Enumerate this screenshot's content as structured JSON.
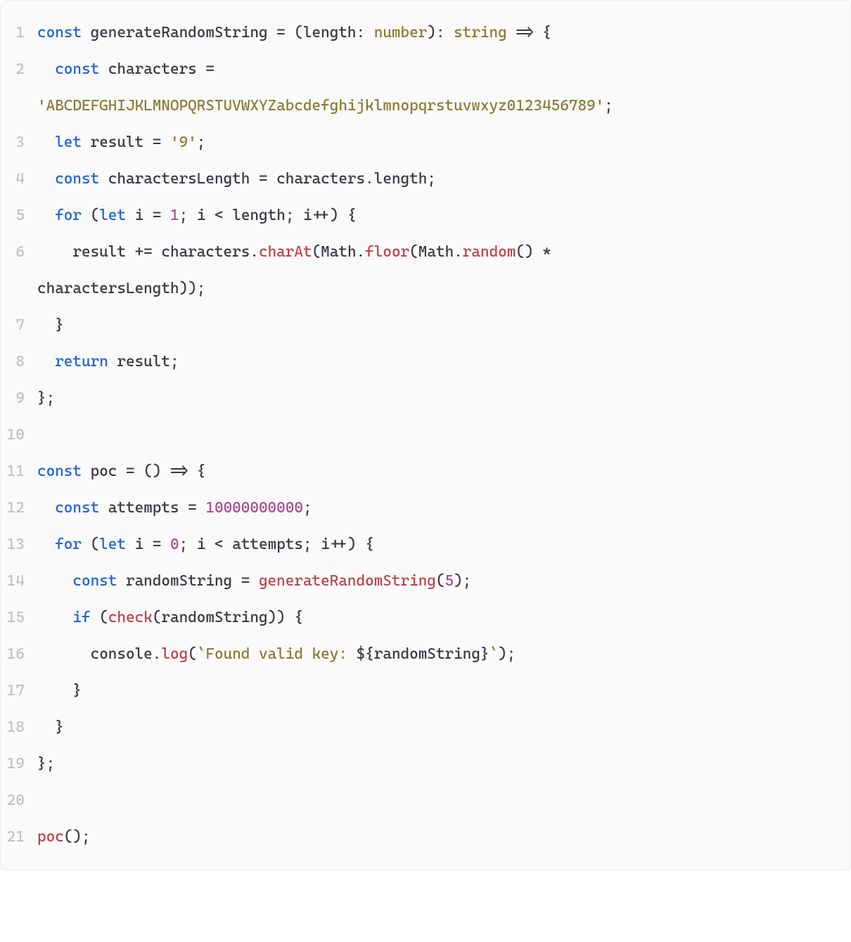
{
  "code": {
    "lines": [
      {
        "num": "1",
        "indent": 0,
        "tokens": [
          {
            "t": "const ",
            "c": "tok-keyword"
          },
          {
            "t": "generateRandomString",
            "c": "tok-def"
          },
          {
            "t": " = (",
            "c": "tok-punct"
          },
          {
            "t": "length",
            "c": "tok-def"
          },
          {
            "t": ": ",
            "c": "tok-punct"
          },
          {
            "t": "number",
            "c": "tok-type"
          },
          {
            "t": "): ",
            "c": "tok-punct"
          },
          {
            "t": "string",
            "c": "tok-type"
          },
          {
            "t": " => {",
            "c": "tok-punct"
          }
        ]
      },
      {
        "num": "2",
        "indent": 1,
        "tokens": [
          {
            "t": "const ",
            "c": "tok-keyword"
          },
          {
            "t": "characters",
            "c": "tok-def"
          },
          {
            "t": " =",
            "c": "tok-op"
          }
        ],
        "wrap_tokens": [
          {
            "t": "'ABCDEFGHIJKLMNOPQRSTUVWXYZabcdefghijklmnopqrstuvwxyz0123456789'",
            "c": "tok-string"
          },
          {
            "t": ";",
            "c": "tok-punct"
          }
        ]
      },
      {
        "num": "3",
        "indent": 1,
        "tokens": [
          {
            "t": "let ",
            "c": "tok-keyword"
          },
          {
            "t": "result",
            "c": "tok-def"
          },
          {
            "t": " = ",
            "c": "tok-op"
          },
          {
            "t": "'9'",
            "c": "tok-string"
          },
          {
            "t": ";",
            "c": "tok-punct"
          }
        ]
      },
      {
        "num": "4",
        "indent": 1,
        "tokens": [
          {
            "t": "const ",
            "c": "tok-keyword"
          },
          {
            "t": "charactersLength",
            "c": "tok-def"
          },
          {
            "t": " = ",
            "c": "tok-op"
          },
          {
            "t": "characters",
            "c": "tok-plain"
          },
          {
            "t": ".",
            "c": "tok-punct"
          },
          {
            "t": "length",
            "c": "tok-plain"
          },
          {
            "t": ";",
            "c": "tok-punct"
          }
        ]
      },
      {
        "num": "5",
        "indent": 1,
        "tokens": [
          {
            "t": "for ",
            "c": "tok-keyword"
          },
          {
            "t": "(",
            "c": "tok-punct"
          },
          {
            "t": "let ",
            "c": "tok-keyword"
          },
          {
            "t": "i",
            "c": "tok-def"
          },
          {
            "t": " = ",
            "c": "tok-op"
          },
          {
            "t": "1",
            "c": "tok-number"
          },
          {
            "t": "; ",
            "c": "tok-punct"
          },
          {
            "t": "i",
            "c": "tok-plain"
          },
          {
            "t": " < ",
            "c": "tok-op"
          },
          {
            "t": "length",
            "c": "tok-plain"
          },
          {
            "t": "; ",
            "c": "tok-punct"
          },
          {
            "t": "i",
            "c": "tok-plain"
          },
          {
            "t": "++",
            "c": "tok-op"
          },
          {
            "t": ") {",
            "c": "tok-punct"
          }
        ]
      },
      {
        "num": "6",
        "indent": 2,
        "tokens": [
          {
            "t": "result",
            "c": "tok-plain"
          },
          {
            "t": " += ",
            "c": "tok-op"
          },
          {
            "t": "characters",
            "c": "tok-plain"
          },
          {
            "t": ".",
            "c": "tok-punct"
          },
          {
            "t": "charAt",
            "c": "tok-call"
          },
          {
            "t": "(",
            "c": "tok-punct"
          },
          {
            "t": "Math",
            "c": "tok-plain"
          },
          {
            "t": ".",
            "c": "tok-punct"
          },
          {
            "t": "floor",
            "c": "tok-call"
          },
          {
            "t": "(",
            "c": "tok-punct"
          },
          {
            "t": "Math",
            "c": "tok-plain"
          },
          {
            "t": ".",
            "c": "tok-punct"
          },
          {
            "t": "random",
            "c": "tok-call"
          },
          {
            "t": "() * ",
            "c": "tok-punct"
          }
        ],
        "wrap_tokens": [
          {
            "t": "charactersLength",
            "c": "tok-plain"
          },
          {
            "t": "));",
            "c": "tok-punct"
          }
        ]
      },
      {
        "num": "7",
        "indent": 1,
        "tokens": [
          {
            "t": "}",
            "c": "tok-punct"
          }
        ]
      },
      {
        "num": "8",
        "indent": 1,
        "tokens": [
          {
            "t": "return ",
            "c": "tok-keyword"
          },
          {
            "t": "result",
            "c": "tok-plain"
          },
          {
            "t": ";",
            "c": "tok-punct"
          }
        ]
      },
      {
        "num": "9",
        "indent": 0,
        "tokens": [
          {
            "t": "};",
            "c": "tok-punct"
          }
        ]
      },
      {
        "num": "10",
        "indent": 0,
        "tokens": []
      },
      {
        "num": "11",
        "indent": 0,
        "tokens": [
          {
            "t": "const ",
            "c": "tok-keyword"
          },
          {
            "t": "poc",
            "c": "tok-def"
          },
          {
            "t": " = () => {",
            "c": "tok-punct"
          }
        ]
      },
      {
        "num": "12",
        "indent": 1,
        "tokens": [
          {
            "t": "const ",
            "c": "tok-keyword"
          },
          {
            "t": "attempts",
            "c": "tok-def"
          },
          {
            "t": " = ",
            "c": "tok-op"
          },
          {
            "t": "10000000000",
            "c": "tok-number"
          },
          {
            "t": ";",
            "c": "tok-punct"
          }
        ]
      },
      {
        "num": "13",
        "indent": 1,
        "tokens": [
          {
            "t": "for ",
            "c": "tok-keyword"
          },
          {
            "t": "(",
            "c": "tok-punct"
          },
          {
            "t": "let ",
            "c": "tok-keyword"
          },
          {
            "t": "i",
            "c": "tok-def"
          },
          {
            "t": " = ",
            "c": "tok-op"
          },
          {
            "t": "0",
            "c": "tok-number"
          },
          {
            "t": "; ",
            "c": "tok-punct"
          },
          {
            "t": "i",
            "c": "tok-plain"
          },
          {
            "t": " < ",
            "c": "tok-op"
          },
          {
            "t": "attempts",
            "c": "tok-plain"
          },
          {
            "t": "; ",
            "c": "tok-punct"
          },
          {
            "t": "i",
            "c": "tok-plain"
          },
          {
            "t": "++",
            "c": "tok-op"
          },
          {
            "t": ") {",
            "c": "tok-punct"
          }
        ]
      },
      {
        "num": "14",
        "indent": 2,
        "tokens": [
          {
            "t": "const ",
            "c": "tok-keyword"
          },
          {
            "t": "randomString",
            "c": "tok-def"
          },
          {
            "t": " = ",
            "c": "tok-op"
          },
          {
            "t": "generateRandomString",
            "c": "tok-call"
          },
          {
            "t": "(",
            "c": "tok-punct"
          },
          {
            "t": "5",
            "c": "tok-number"
          },
          {
            "t": ");",
            "c": "tok-punct"
          }
        ]
      },
      {
        "num": "15",
        "indent": 2,
        "tokens": [
          {
            "t": "if ",
            "c": "tok-keyword"
          },
          {
            "t": "(",
            "c": "tok-punct"
          },
          {
            "t": "check",
            "c": "tok-call"
          },
          {
            "t": "(",
            "c": "tok-punct"
          },
          {
            "t": "randomString",
            "c": "tok-plain"
          },
          {
            "t": ")) {",
            "c": "tok-punct"
          }
        ]
      },
      {
        "num": "16",
        "indent": 3,
        "tokens": [
          {
            "t": "console",
            "c": "tok-plain"
          },
          {
            "t": ".",
            "c": "tok-punct"
          },
          {
            "t": "log",
            "c": "tok-call"
          },
          {
            "t": "(",
            "c": "tok-punct"
          },
          {
            "t": "`Found valid key: ",
            "c": "tok-string"
          },
          {
            "t": "${",
            "c": "tok-punct"
          },
          {
            "t": "randomString",
            "c": "tok-plain"
          },
          {
            "t": "}",
            "c": "tok-punct"
          },
          {
            "t": "`",
            "c": "tok-string"
          },
          {
            "t": ");",
            "c": "tok-punct"
          }
        ]
      },
      {
        "num": "17",
        "indent": 2,
        "tokens": [
          {
            "t": "}",
            "c": "tok-punct"
          }
        ]
      },
      {
        "num": "18",
        "indent": 1,
        "tokens": [
          {
            "t": "}",
            "c": "tok-punct"
          }
        ]
      },
      {
        "num": "19",
        "indent": 0,
        "tokens": [
          {
            "t": "};",
            "c": "tok-punct"
          }
        ]
      },
      {
        "num": "20",
        "indent": 0,
        "tokens": []
      },
      {
        "num": "21",
        "indent": 0,
        "tokens": [
          {
            "t": "poc",
            "c": "tok-call"
          },
          {
            "t": "();",
            "c": "tok-punct"
          }
        ]
      }
    ]
  }
}
